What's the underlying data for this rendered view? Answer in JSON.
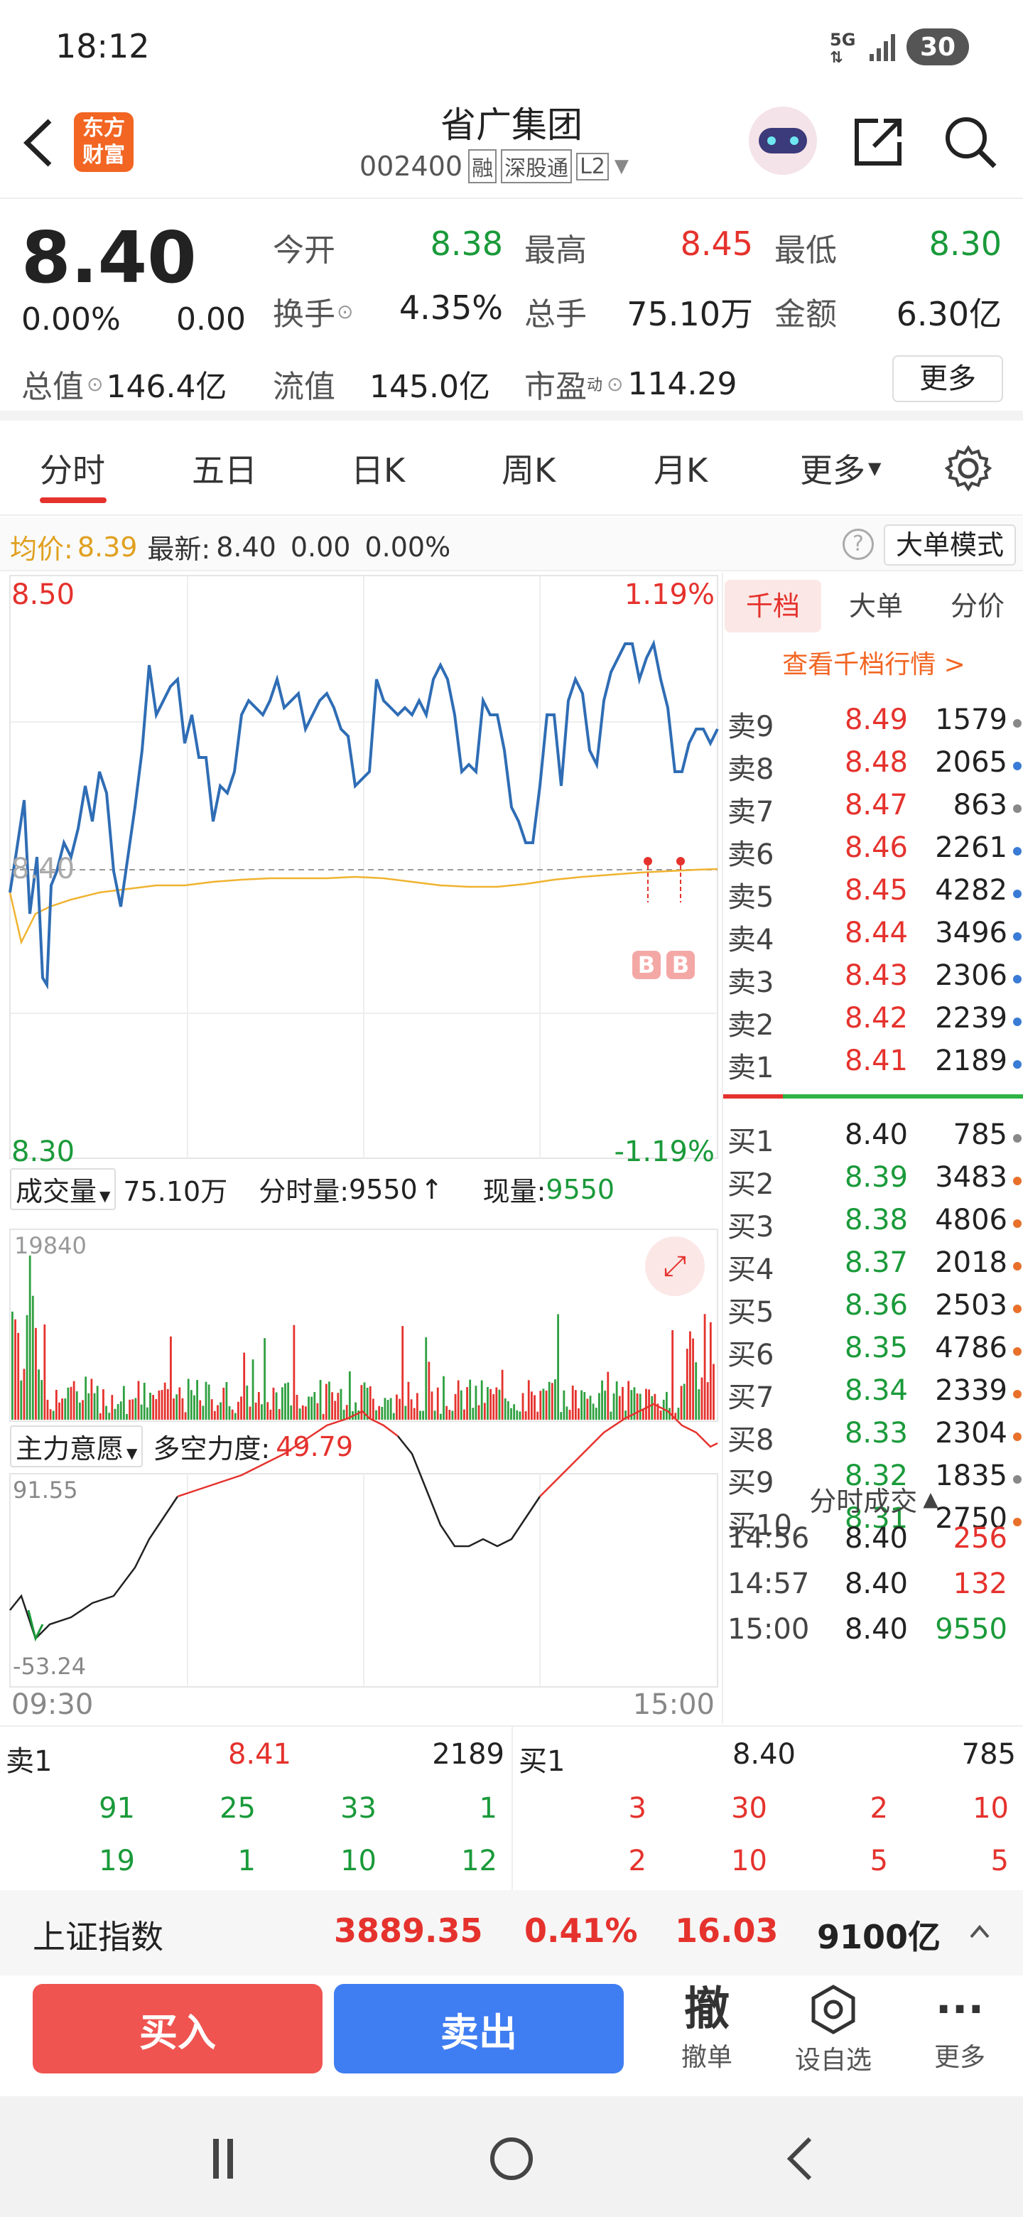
{
  "status": {
    "time": "18:12",
    "network": "5G",
    "battery": "30"
  },
  "header": {
    "logo_line1": "东方",
    "logo_line2": "财富",
    "name": "省广集团",
    "code": "002400",
    "tags": [
      "融",
      "深股通",
      "L2"
    ]
  },
  "quote": {
    "price": "8.40",
    "change_pct": "0.00%",
    "change": "0.00",
    "open_label": "今开",
    "open": "8.38",
    "high_label": "最高",
    "high": "8.45",
    "low_label": "最低",
    "low": "8.30",
    "turnover_label": "换手",
    "turnover": "4.35%",
    "volume_label": "总手",
    "volume": "75.10万",
    "amount_label": "金额",
    "amount": "6.30亿",
    "mktcap_label": "总值",
    "mktcap": "146.4亿",
    "float_label": "流值",
    "float": "145.0亿",
    "pe_label": "市盈",
    "pe_sup": "动",
    "pe": "114.29",
    "more": "更多"
  },
  "tabs": [
    "分时",
    "五日",
    "日K",
    "周K",
    "月K",
    "更多"
  ],
  "avgbar": {
    "avg_label": "均价:",
    "avg": "8.39",
    "latest_label": "最新:",
    "latest": "8.40",
    "chg": "0.00",
    "pct": "0.00%",
    "mode": "大单模式"
  },
  "chart": {
    "top_price": "8.50",
    "top_pct": "1.19%",
    "mid_price": "8.40",
    "bottom_price": "8.30",
    "bottom_pct": "-1.19%",
    "marker": "B",
    "vol_label": "成交量",
    "vol_total": "75.10万",
    "vol_tick_label": "分时量:",
    "vol_tick": "9550",
    "vol_now_label": "现量:",
    "vol_now": "9550",
    "vol_max": "19840",
    "ind_label": "主力意愿",
    "ind_name": "多空力度:",
    "ind_value": "49.79",
    "ind_max": "91.55",
    "ind_min": "-53.24",
    "time_start": "09:30",
    "time_end": "15:00"
  },
  "orderbook": {
    "tabs": [
      "千档",
      "大单",
      "分价"
    ],
    "link": "查看千档行情 >",
    "asks": [
      {
        "label": "卖9",
        "price": "8.49",
        "vol": "1579"
      },
      {
        "label": "卖8",
        "price": "8.48",
        "vol": "2065"
      },
      {
        "label": "卖7",
        "price": "8.47",
        "vol": "863"
      },
      {
        "label": "卖6",
        "price": "8.46",
        "vol": "2261"
      },
      {
        "label": "卖5",
        "price": "8.45",
        "vol": "4282"
      },
      {
        "label": "卖4",
        "price": "8.44",
        "vol": "3496"
      },
      {
        "label": "卖3",
        "price": "8.43",
        "vol": "2306"
      },
      {
        "label": "卖2",
        "price": "8.42",
        "vol": "2239"
      },
      {
        "label": "卖1",
        "price": "8.41",
        "vol": "2189"
      }
    ],
    "ask_dots": [
      "#888888",
      "#3a7bd5",
      "#888888",
      "#3a7bd5",
      "#3a7bd5",
      "#3a7bd5",
      "#3a7bd5",
      "#3a7bd5",
      "#3a7bd5"
    ],
    "bids": [
      {
        "label": "买1",
        "price": "8.40",
        "vol": "785"
      },
      {
        "label": "买2",
        "price": "8.39",
        "vol": "3483"
      },
      {
        "label": "买3",
        "price": "8.38",
        "vol": "4806"
      },
      {
        "label": "买4",
        "price": "8.37",
        "vol": "2018"
      },
      {
        "label": "买5",
        "price": "8.36",
        "vol": "2503"
      },
      {
        "label": "买6",
        "price": "8.35",
        "vol": "4786"
      },
      {
        "label": "买7",
        "price": "8.34",
        "vol": "2339"
      },
      {
        "label": "买8",
        "price": "8.33",
        "vol": "2304"
      },
      {
        "label": "买9",
        "price": "8.32",
        "vol": "1835"
      },
      {
        "label": "买10",
        "price": "8.31",
        "vol": "2750"
      }
    ],
    "bid_dots": [
      "#888888",
      "#e8702a",
      "#e8702a",
      "#e8702a",
      "#e8702a",
      "#e8702a",
      "#e8702a",
      "#e8702a",
      "#888888",
      "#e8702a"
    ],
    "trades_title": "分时成交",
    "trades": [
      {
        "time": "14:56",
        "price": "8.40",
        "vol": "256",
        "color": "#e5322d"
      },
      {
        "time": "14:57",
        "price": "8.40",
        "vol": "132",
        "color": "#e5322d"
      },
      {
        "time": "15:00",
        "price": "8.40",
        "vol": "9550",
        "color": "#1a9a3a"
      }
    ]
  },
  "level1": {
    "ask_label": "卖1",
    "ask_price": "8.41",
    "ask_vol": "2189",
    "bid_label": "买1",
    "bid_price": "8.40",
    "bid_vol": "785",
    "ask_q1": [
      "91",
      "25",
      "33",
      "1"
    ],
    "ask_q2": [
      "19",
      "1",
      "10",
      "12"
    ],
    "bid_q1": [
      "3",
      "30",
      "2",
      "10"
    ],
    "bid_q2": [
      "2",
      "10",
      "5",
      "5"
    ]
  },
  "index": {
    "name": "上证指数",
    "value": "3889.35",
    "pct": "0.41%",
    "chg": "16.03",
    "amount": "9100亿"
  },
  "actions": {
    "buy": "买入",
    "sell": "卖出",
    "cancel_glyph": "撤",
    "cancel": "撤单",
    "watch": "设自选",
    "more": "更多"
  },
  "colors": {
    "up": "#e5322d",
    "down": "#1a9a3a",
    "line": "#2f6db5",
    "avg": "#f0b330",
    "buy_btn": "#ef5450",
    "sell_btn": "#3f7df2"
  }
}
